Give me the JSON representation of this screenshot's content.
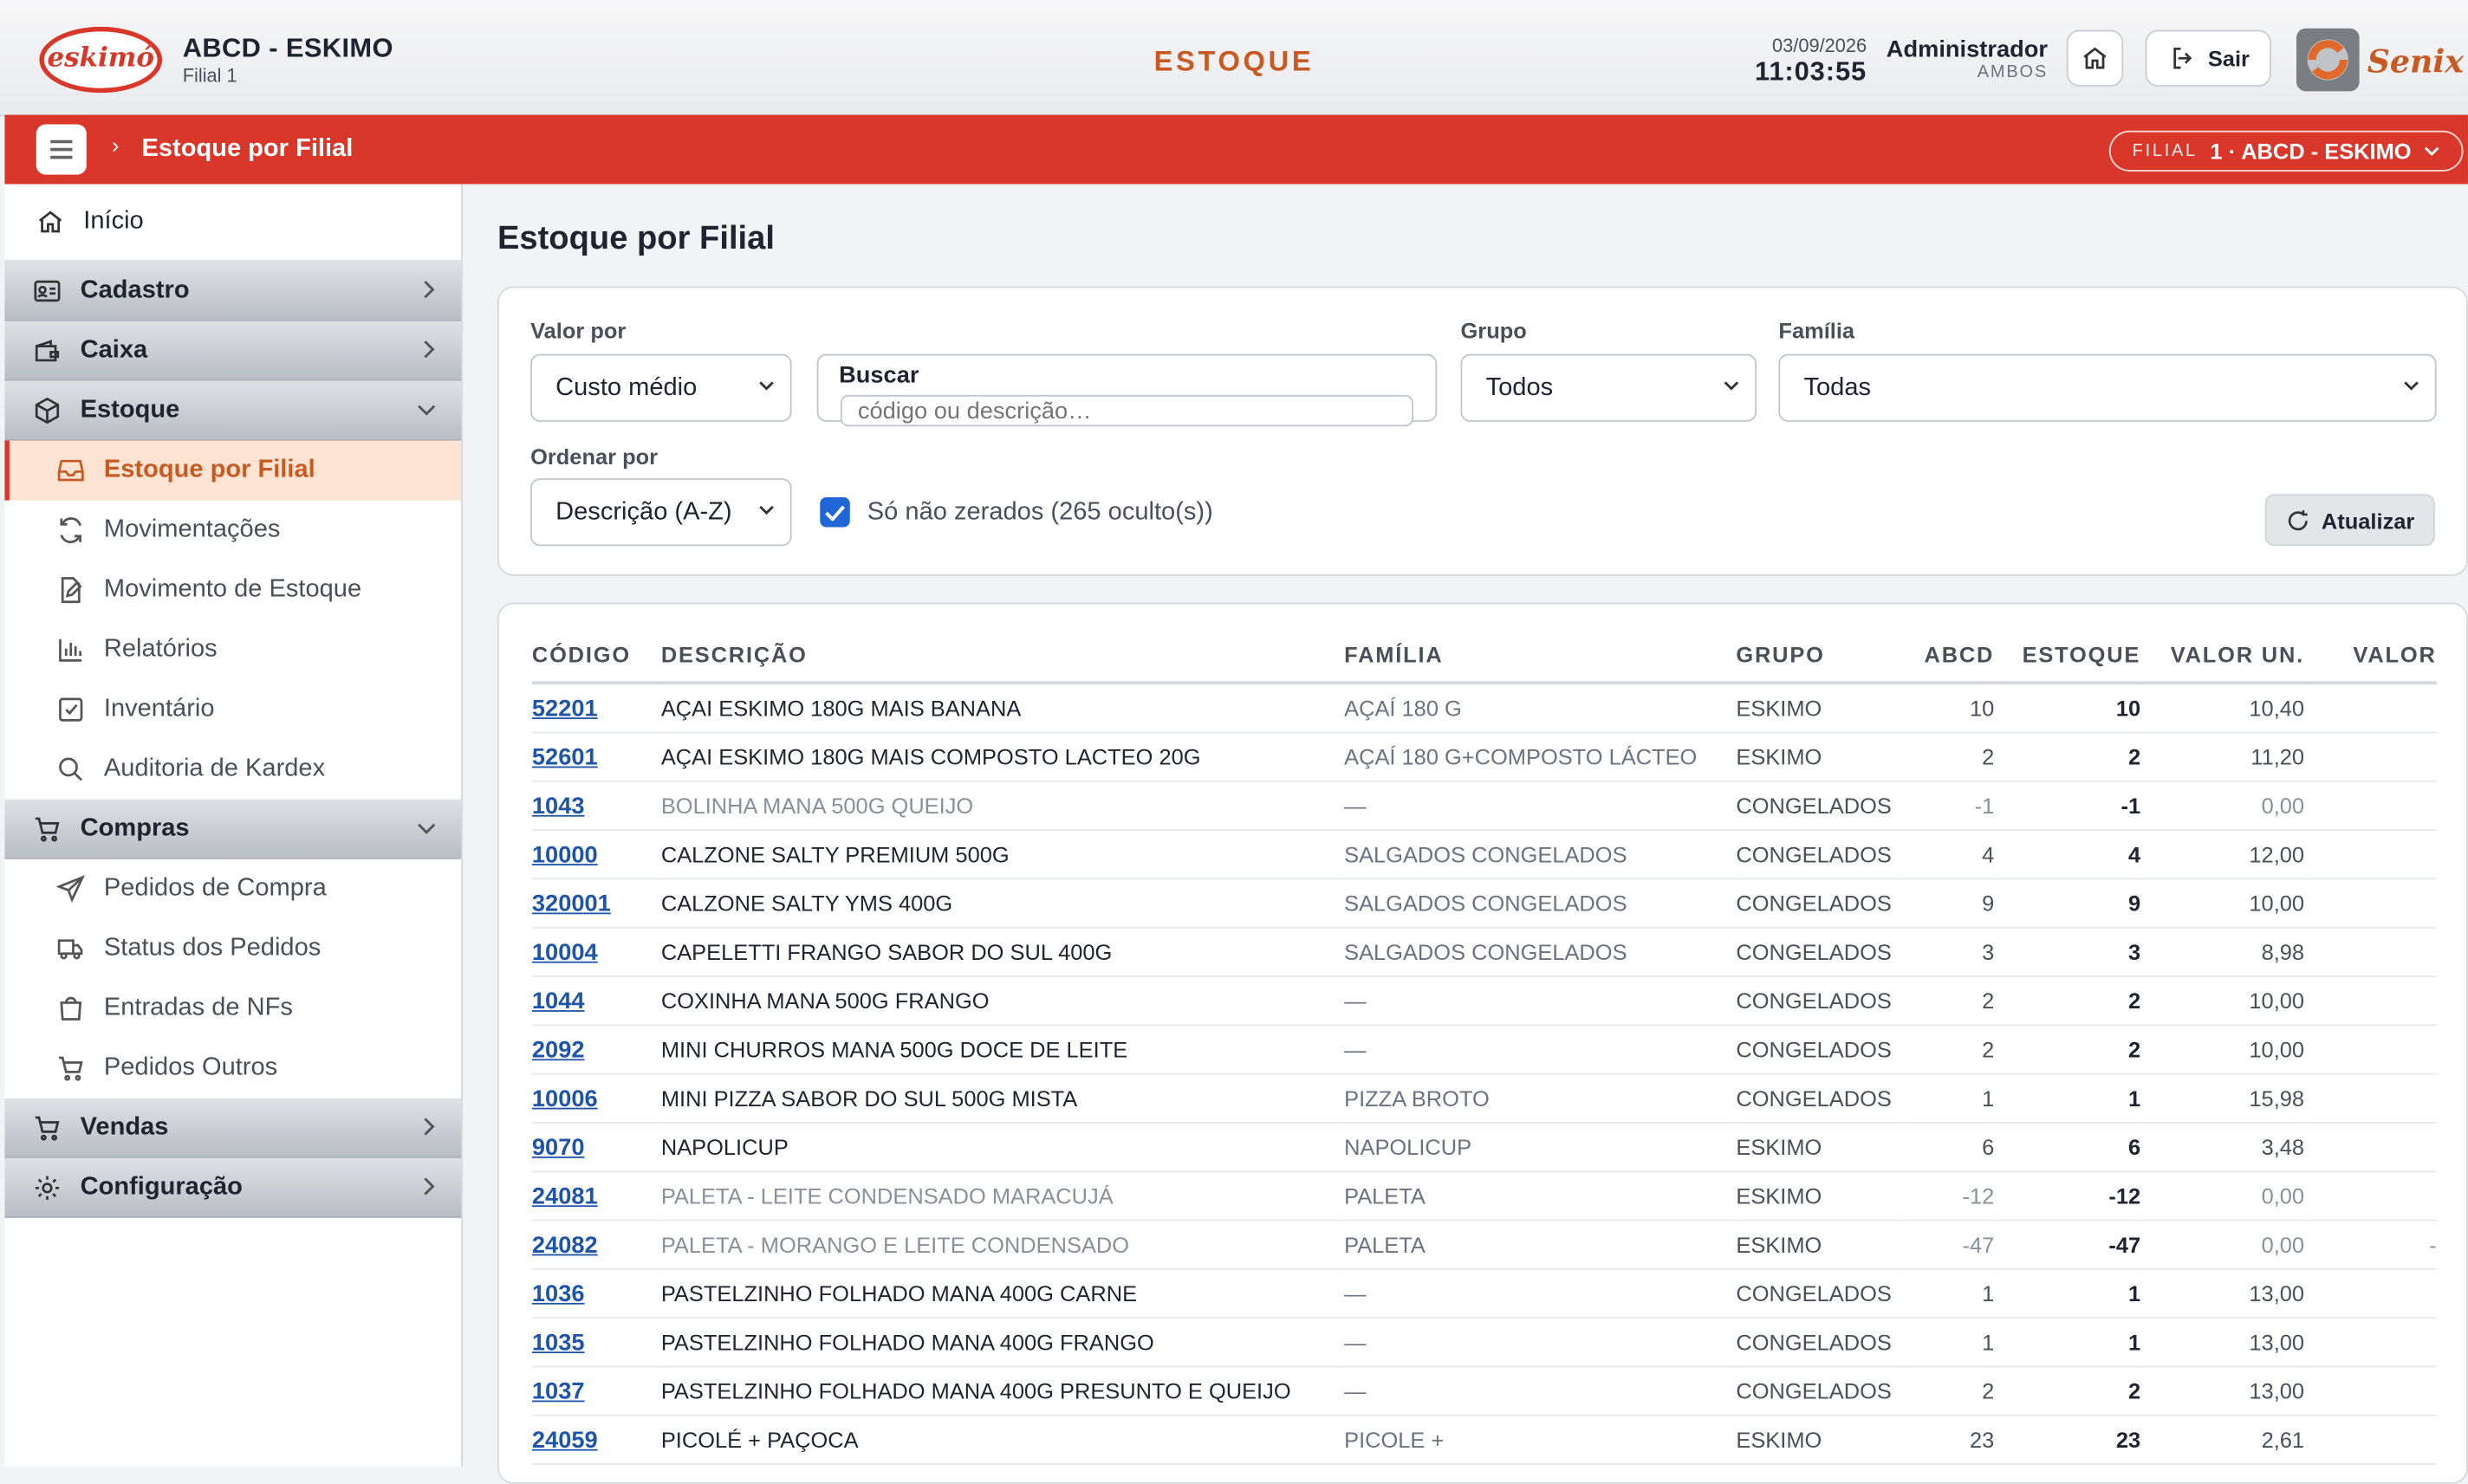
{
  "header": {
    "logo_text": "eskimó",
    "company": "ABCD - ESKIMO",
    "subsidiary": "Filial 1",
    "page_heading": "ESTOQUE",
    "date": "03/09/2026",
    "time": "11:03:55",
    "user_name": "Administrador",
    "user_role": "AMBOS",
    "exit_label": "Sair",
    "brand_logo_text": "Senix"
  },
  "topbar": {
    "breadcrumb": "Estoque por Filial",
    "branch_label": "FILIAL",
    "branch_value": "1 · ABCD - ESKIMO"
  },
  "sidebar": {
    "home": "Início",
    "groups": [
      {
        "label": "Cadastro",
        "icon": "id-card-icon",
        "expanded": false
      },
      {
        "label": "Caixa",
        "icon": "wallet-icon",
        "expanded": false
      },
      {
        "label": "Estoque",
        "icon": "box-icon",
        "expanded": true,
        "items": [
          "Estoque por Filial",
          "Movimentações",
          "Movimento de Estoque",
          "Relatórios",
          "Inventário",
          "Auditoria de Kardex"
        ]
      },
      {
        "label": "Compras",
        "icon": "cart-icon",
        "expanded": true,
        "items": [
          "Pedidos de Compra",
          "Status dos Pedidos",
          "Entradas de NFs",
          "Pedidos Outros"
        ]
      },
      {
        "label": "Vendas",
        "icon": "cart-icon",
        "expanded": false
      },
      {
        "label": "Configuração",
        "icon": "gear-icon",
        "expanded": false
      }
    ],
    "active_item": "Estoque por Filial"
  },
  "main": {
    "title": "Estoque por Filial",
    "filters": {
      "valor_por_label": "Valor por",
      "valor_por_value": "Custo médio",
      "buscar_label": "Buscar",
      "buscar_placeholder": "código ou descrição…",
      "grupo_label": "Grupo",
      "grupo_value": "Todos",
      "familia_label": "Família",
      "familia_value": "Todas",
      "ordenar_label": "Ordenar por",
      "ordenar_value": "Descrição (A-Z)",
      "checkbox_label": "Só não zerados (265 oculto(s))",
      "checkbox_checked": true,
      "refresh_label": "Atualizar"
    },
    "table": {
      "columns": [
        "CÓDIGO",
        "DESCRIÇÃO",
        "FAMÍLIA",
        "GRUPO",
        "ABCD",
        "ESTOQUE",
        "VALOR UN.",
        "VALOR"
      ],
      "rows": [
        [
          "52201",
          "AÇAI ESKIMO 180G MAIS BANANA",
          "AÇAÍ 180 G",
          "ESKIMO",
          "10",
          "10",
          "10,40",
          ""
        ],
        [
          "52601",
          "AÇAI ESKIMO 180G MAIS COMPOSTO LACTEO 20G",
          "AÇAÍ 180 G+COMPOSTO LÁCTEO",
          "ESKIMO",
          "2",
          "2",
          "11,20",
          ""
        ],
        [
          "1043",
          "BOLINHA MANA 500G QUEIJO",
          "—",
          "CONGELADOS",
          "-1",
          "-1",
          "0,00",
          ""
        ],
        [
          "10000",
          "CALZONE SALTY PREMIUM 500G",
          "SALGADOS CONGELADOS",
          "CONGELADOS",
          "4",
          "4",
          "12,00",
          ""
        ],
        [
          "320001",
          "CALZONE SALTY YMS 400G",
          "SALGADOS CONGELADOS",
          "CONGELADOS",
          "9",
          "9",
          "10,00",
          ""
        ],
        [
          "10004",
          "CAPELETTI FRANGO SABOR DO SUL 400G",
          "SALGADOS CONGELADOS",
          "CONGELADOS",
          "3",
          "3",
          "8,98",
          ""
        ],
        [
          "1044",
          "COXINHA MANA 500G FRANGO",
          "—",
          "CONGELADOS",
          "2",
          "2",
          "10,00",
          ""
        ],
        [
          "2092",
          "MINI CHURROS MANA 500G DOCE DE LEITE",
          "—",
          "CONGELADOS",
          "2",
          "2",
          "10,00",
          ""
        ],
        [
          "10006",
          "MINI PIZZA SABOR DO SUL 500G MISTA",
          "PIZZA BROTO",
          "CONGELADOS",
          "1",
          "1",
          "15,98",
          ""
        ],
        [
          "9070",
          "NAPOLICUP",
          "NAPOLICUP",
          "ESKIMO",
          "6",
          "6",
          "3,48",
          ""
        ],
        [
          "24081",
          "PALETA - LEITE CONDENSADO MARACUJÁ",
          "PALETA",
          "ESKIMO",
          "-12",
          "-12",
          "0,00",
          ""
        ],
        [
          "24082",
          "PALETA - MORANGO E LEITE CONDENSADO",
          "PALETA",
          "ESKIMO",
          "-47",
          "-47",
          "0,00",
          "-"
        ],
        [
          "1036",
          "PASTELZINHO FOLHADO MANA 400G CARNE",
          "—",
          "CONGELADOS",
          "1",
          "1",
          "13,00",
          ""
        ],
        [
          "1035",
          "PASTELZINHO FOLHADO MANA 400G FRANGO",
          "—",
          "CONGELADOS",
          "1",
          "1",
          "13,00",
          ""
        ],
        [
          "1037",
          "PASTELZINHO FOLHADO MANA 400G PRESUNTO E QUEIJO",
          "—",
          "CONGELADOS",
          "2",
          "2",
          "13,00",
          ""
        ],
        [
          "24059",
          "PICOLÉ + PAÇOCA",
          "PICOLE +",
          "ESKIMO",
          "23",
          "23",
          "2,61",
          ""
        ]
      ]
    }
  },
  "colors": {
    "accent_red": "#d8372a",
    "heading_orange": "#c75a23",
    "link_blue": "#1f55a8",
    "active_bg": "#fde3d2"
  }
}
